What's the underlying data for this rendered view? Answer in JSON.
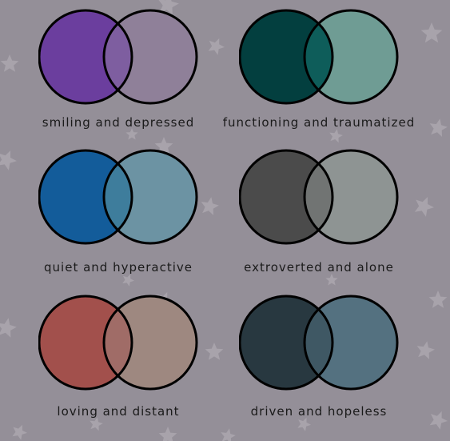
{
  "pairs": [
    {
      "caption": "smiling and depressed",
      "left_color": "#6b3e9e",
      "right_color": "#8f8099",
      "overlap_color": "#7e5ea0"
    },
    {
      "caption": "functioning and traumatized",
      "left_color": "#033f3f",
      "right_color": "#6f9c94",
      "overlap_color": "#0e5d5a"
    },
    {
      "caption": "quiet and hyperactive",
      "left_color": "#135c9a",
      "right_color": "#6c93a3",
      "overlap_color": "#3e7d9c"
    },
    {
      "caption": "extroverted and alone",
      "left_color": "#4b4b4b",
      "right_color": "#8e9493",
      "overlap_color": "#717473"
    },
    {
      "caption": "loving and distant",
      "left_color": "#a2504c",
      "right_color": "#9e8880",
      "overlap_color": "#a06c67"
    },
    {
      "caption": "driven and hopeless",
      "left_color": "#283840",
      "right_color": "#547180",
      "overlap_color": "#3f5864"
    }
  ],
  "background_color": "#948f98",
  "star_color": "#a8a3ab"
}
